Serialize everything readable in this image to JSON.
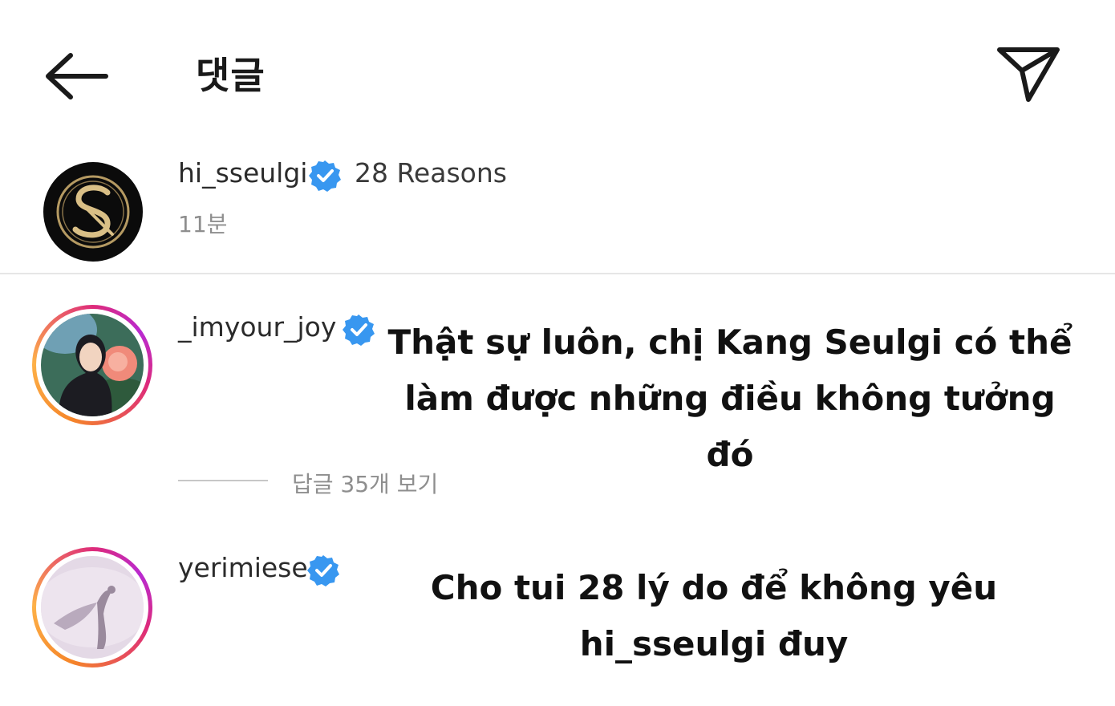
{
  "header": {
    "title": "댓글"
  },
  "caption": {
    "username": "hi_sseulgi",
    "text": "28 Reasons",
    "time": "11분"
  },
  "comments": [
    {
      "username": "_imyour_joy",
      "overlay_text": "Thật sự luôn, chị Kang Seulgi có thể làm được những điều không tưởng đó",
      "view_replies": "답글 35개 보기"
    },
    {
      "username": "yerimiese",
      "overlay_text": "Cho tui 28 lý do để không yêu hi_sseulgi đuy"
    }
  ],
  "colors": {
    "verified": "#3897f0",
    "muted_text": "#8e8e8e"
  },
  "icons": [
    "back-arrow-icon",
    "direct-send-icon",
    "verified-badge-icon"
  ]
}
